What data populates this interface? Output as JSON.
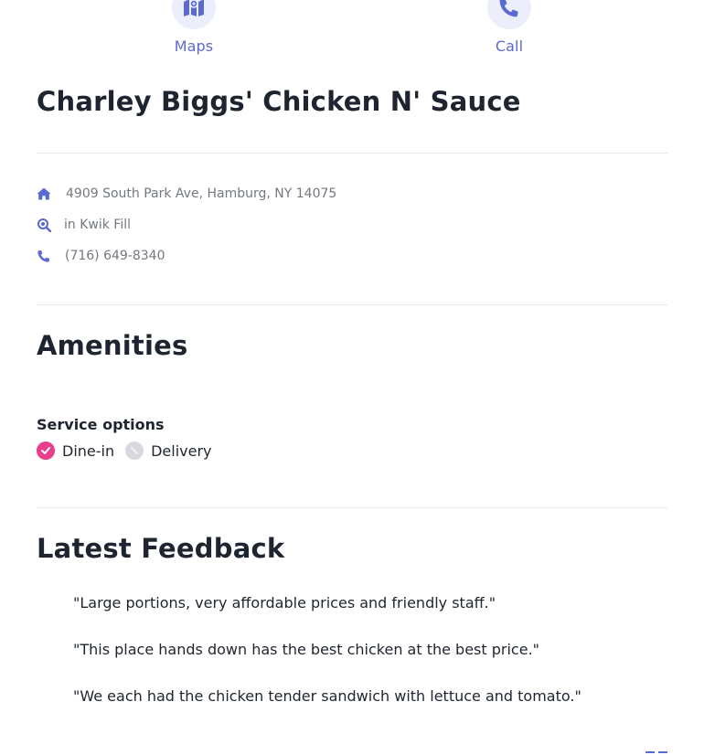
{
  "actions": {
    "maps": {
      "label": "Maps",
      "icon": "map-icon"
    },
    "call": {
      "label": "Call",
      "icon": "phone-icon"
    }
  },
  "business": {
    "name": "Charley Biggs' Chicken N' Sauce",
    "address": "4909 South Park Ave, Hamburg, NY 14075",
    "located_in": "in Kwik Fill",
    "phone": "(716) 649-8340"
  },
  "amenities": {
    "title": "Amenities",
    "service_options": {
      "label": "Service options",
      "items": [
        {
          "label": "Dine-in",
          "available": true
        },
        {
          "label": "Delivery",
          "available": false
        }
      ]
    }
  },
  "feedback": {
    "title": "Latest Feedback",
    "items": [
      "\"Large portions, very affordable prices and friendly staff.\"",
      "\"This place hands down has the best chicken at the best price.\"",
      "\"We each had the chicken tender sandwich with lettuce and tomato.\""
    ]
  },
  "colors": {
    "accent": "#5b6ad0",
    "available": "#e83e8c",
    "unavailable": "#d7d9de",
    "heading": "#1f2530",
    "muted": "#737880"
  }
}
